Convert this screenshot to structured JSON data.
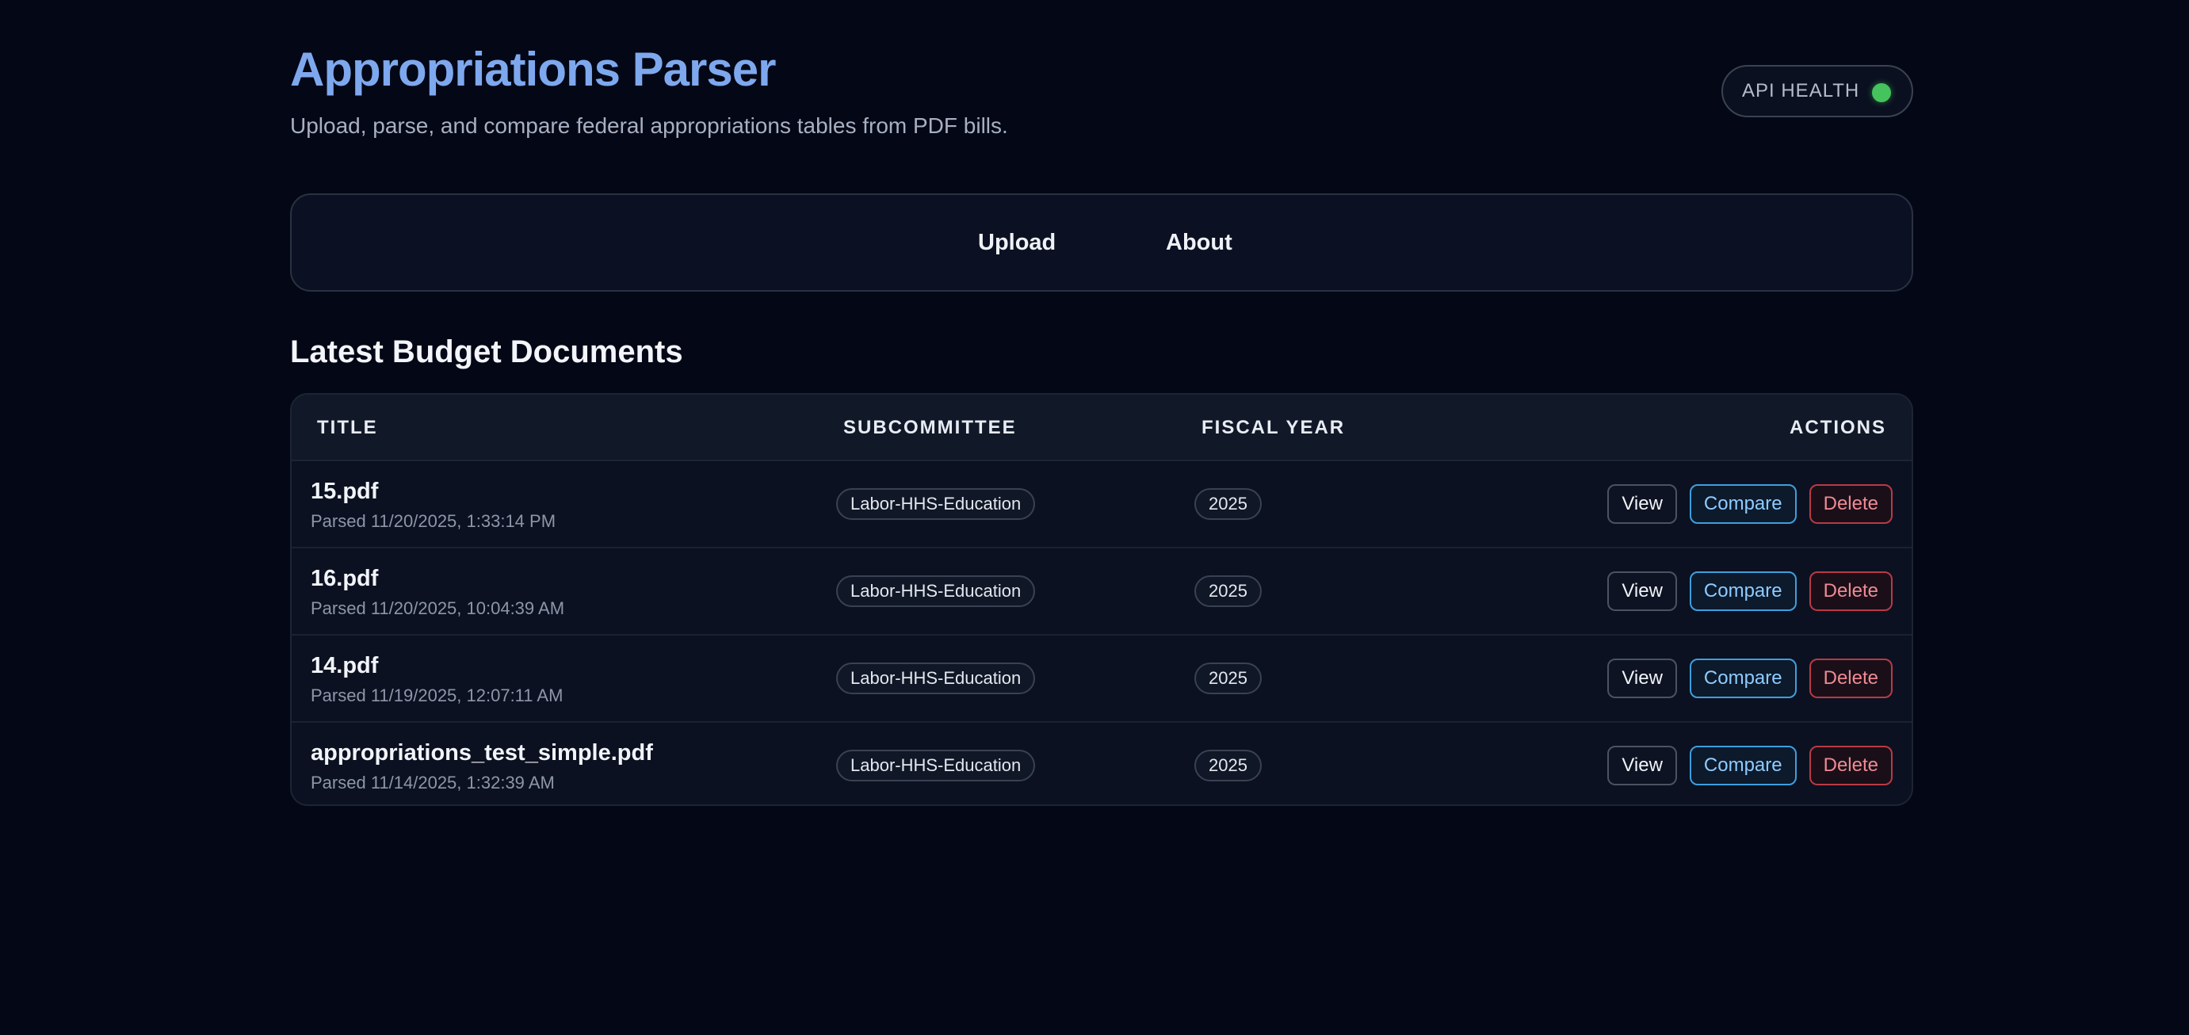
{
  "header": {
    "title": "Appropriations Parser",
    "subtitle": "Upload, parse, and compare federal appropriations tables from PDF bills.",
    "health_label": "API HEALTH",
    "health_status_color": "#45c35c"
  },
  "nav": {
    "items": [
      {
        "label": "Upload"
      },
      {
        "label": "About"
      }
    ]
  },
  "section": {
    "title": "Latest Budget Documents"
  },
  "table": {
    "columns": [
      "TITLE",
      "SUBCOMMITTEE",
      "FISCAL YEAR",
      "ACTIONS"
    ],
    "rows": [
      {
        "title": "15.pdf",
        "parsed": "Parsed 11/20/2025, 1:33:14 PM",
        "subcommittee": "Labor-HHS-Education",
        "fiscal_year": "2025"
      },
      {
        "title": "16.pdf",
        "parsed": "Parsed 11/20/2025, 10:04:39 AM",
        "subcommittee": "Labor-HHS-Education",
        "fiscal_year": "2025"
      },
      {
        "title": "14.pdf",
        "parsed": "Parsed 11/19/2025, 12:07:11 AM",
        "subcommittee": "Labor-HHS-Education",
        "fiscal_year": "2025"
      },
      {
        "title": "appropriations_test_simple.pdf",
        "parsed": "Parsed 11/14/2025, 1:32:39 AM",
        "subcommittee": "Labor-HHS-Education",
        "fiscal_year": "2025"
      }
    ],
    "actions": {
      "view": "View",
      "compare": "Compare",
      "delete": "Delete"
    }
  },
  "colors": {
    "background": "#040716",
    "title_accent": "#7ea8ee",
    "compare_accent": "#3f9ede",
    "delete_accent": "#b83a45"
  }
}
